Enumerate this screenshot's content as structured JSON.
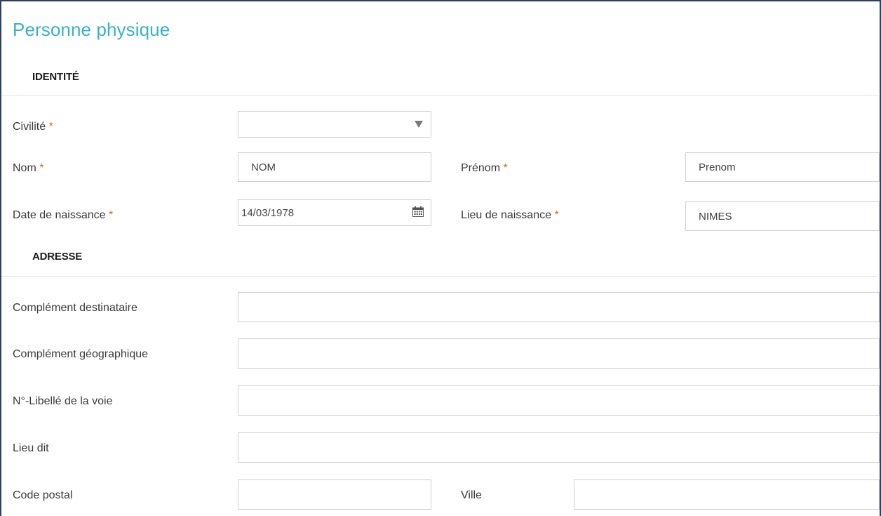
{
  "form": {
    "title": "Personne physique",
    "required_mark": "*",
    "sections": {
      "identite": "IDENTITÉ",
      "adresse": "ADRESSE"
    },
    "identite": {
      "civilite": {
        "label": "Civilité",
        "value": ""
      },
      "nom": {
        "label": "Nom",
        "value": "NOM"
      },
      "prenom": {
        "label": "Prénom",
        "value": "Prenom"
      },
      "date_naissance": {
        "label": "Date de naissance",
        "value": "14/03/1978"
      },
      "lieu_naissance": {
        "label": "Lieu de naissance",
        "value": "NIMES"
      }
    },
    "adresse": {
      "complement_destinataire": {
        "label": "Complément destinataire",
        "value": ""
      },
      "complement_geographique": {
        "label": "Complément géographique",
        "value": ""
      },
      "libelle_voie": {
        "label": "N°-Libellé de la voie",
        "value": ""
      },
      "lieu_dit": {
        "label": "Lieu dit",
        "value": ""
      },
      "code_postal": {
        "label": "Code postal",
        "value": ""
      },
      "ville": {
        "label": "Ville",
        "value": ""
      }
    }
  },
  "colors": {
    "title": "#37b3c4",
    "required": "#e0651c",
    "frame": "#2f3f5e",
    "field_border": "#cfcfcf"
  },
  "icons": {
    "civilite_dropdown": "triangle-down-icon",
    "date_picker": "calendar-icon"
  }
}
